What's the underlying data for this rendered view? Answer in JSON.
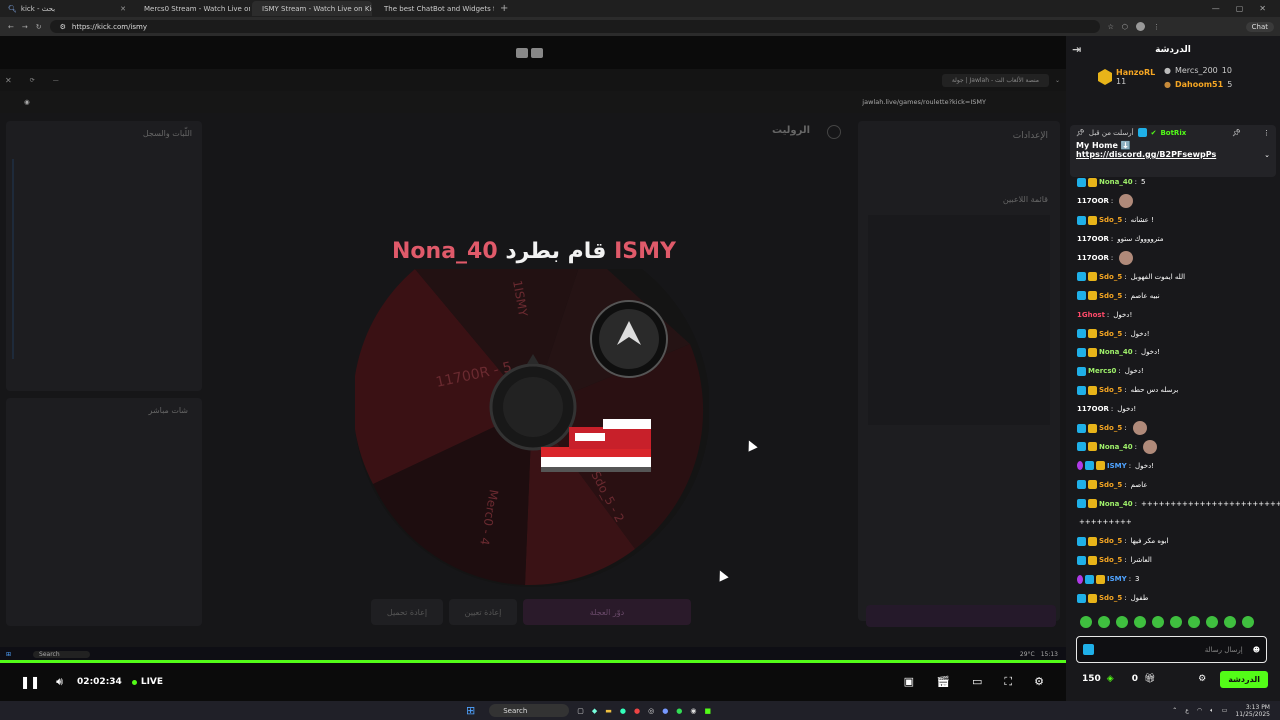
{
  "browser": {
    "tabs": [
      {
        "label": "kick - بحث",
        "active": false
      },
      {
        "label": "Mercs0 Stream - Watch Live on Ki",
        "active": false
      },
      {
        "label": "ISMY Stream - Watch Live on Kick",
        "active": true
      },
      {
        "label": "The best ChatBot and Widgets fo",
        "active": false
      }
    ],
    "url": "https://kick.com/ismy",
    "chat_button": "Chat"
  },
  "inner_browser": {
    "tab_label": "جولة | Jawlah - منصة الألعاب الت",
    "url": "jawlah.live/games/roulette?kick=ISMY",
    "page_title": "الروليت",
    "settings_label": "الإعدادات",
    "players_label": "قائمة اللاعبين",
    "log_label": "اللّبات والسجل",
    "live_chat_label": "شات مباشر",
    "spin_button": "دوّر العجلة",
    "reset_button": "إعادة تعيين",
    "reload_button": "إعادة تحميل"
  },
  "game": {
    "kicker": "ISMY",
    "action": "قام بطرد",
    "kicked": "Nona_40",
    "wheel_segments": [
      "11700R - 5",
      "Sdo_5 - 2",
      "Merc0 - 4",
      "1ISMY"
    ]
  },
  "player": {
    "time": "02:02:34",
    "live_label": "LIVE",
    "inner_clock": "15:13",
    "inner_weather": "29°C"
  },
  "chat": {
    "title": "الدردشة",
    "leaders": [
      {
        "name": "HanzoRL",
        "count": "11"
      },
      {
        "name": "Mercs_200",
        "count": "10"
      },
      {
        "name": "Dahoom51",
        "count": "5"
      }
    ],
    "pinned": {
      "by": "أرسلت من قبل",
      "user": "BotRix",
      "line1": "My Home ⬇️",
      "link": "https://discord.gg/B2PFsewpPs"
    },
    "messages": [
      {
        "user": "Nona_40",
        "color": "green",
        "badges": 2,
        "text": "5"
      },
      {
        "user": "117OOR",
        "color": "white",
        "badges": 0,
        "text": "",
        "emote": true
      },
      {
        "user": "Sdo_5",
        "color": "orange",
        "badges": 2,
        "text": "عشانه !"
      },
      {
        "user": "117OOR",
        "color": "white",
        "badges": 0,
        "text": "مترووووك ستوو"
      },
      {
        "user": "117OOR",
        "color": "white",
        "badges": 0,
        "text": "",
        "emote": true
      },
      {
        "user": "Sdo_5",
        "color": "orange",
        "badges": 2,
        "text": "الله ايموت الفهوبل"
      },
      {
        "user": "Sdo_5",
        "color": "orange",
        "badges": 2,
        "text": "نبيه عاصم"
      },
      {
        "user": "1Ghost",
        "color": "red",
        "badges": 0,
        "text": "دخول!"
      },
      {
        "user": "Sdo_5",
        "color": "orange",
        "badges": 2,
        "text": "دخول!"
      },
      {
        "user": "Nona_40",
        "color": "green",
        "badges": 2,
        "text": "دخول!"
      },
      {
        "user": "Mercs0",
        "color": "green",
        "badges": 1,
        "text": "دخول!"
      },
      {
        "user": "Sdo_5",
        "color": "orange",
        "badges": 2,
        "text": "برسله دس حطه"
      },
      {
        "user": "117OOR",
        "color": "white",
        "badges": 0,
        "text": "دخول!"
      },
      {
        "user": "Sdo_5",
        "color": "orange",
        "badges": 2,
        "text": "",
        "emote": true
      },
      {
        "user": "Nona_40",
        "color": "green",
        "badges": 2,
        "text": "",
        "emote": true
      },
      {
        "user": "ISMY",
        "color": "blue",
        "badges": 3,
        "text": "دخول!"
      },
      {
        "user": "Sdo_5",
        "color": "orange",
        "badges": 2,
        "text": "عاصم"
      },
      {
        "user": "Nona_40",
        "color": "green",
        "badges": 2,
        "text": "+++++++++++++++++++++++++++++++++++++++++++++++++++++++++"
      },
      {
        "user": "",
        "color": "white",
        "badges": 0,
        "text": "+++++++++"
      },
      {
        "user": "Sdo_5",
        "color": "orange",
        "badges": 2,
        "text": "ابوه مكر فيها"
      },
      {
        "user": "Sdo_5",
        "color": "orange",
        "badges": 2,
        "text": "العاشرا"
      },
      {
        "user": "ISMY",
        "color": "blue",
        "badges": 3,
        "text": "3"
      },
      {
        "user": "Sdo_5",
        "color": "orange",
        "badges": 2,
        "text": "طفول"
      }
    ],
    "input_placeholder": "إرسال رسالة",
    "points": "150",
    "gifts": "0",
    "send_label": "الدردشة"
  },
  "taskbar": {
    "search_label": "Search",
    "time": "3:13 PM",
    "date": "11/25/2025",
    "lang": "ع"
  },
  "colors": {
    "kick_green": "#53fc18",
    "chat_bg": "#18181b",
    "kicker_color": "#e05a6a"
  }
}
